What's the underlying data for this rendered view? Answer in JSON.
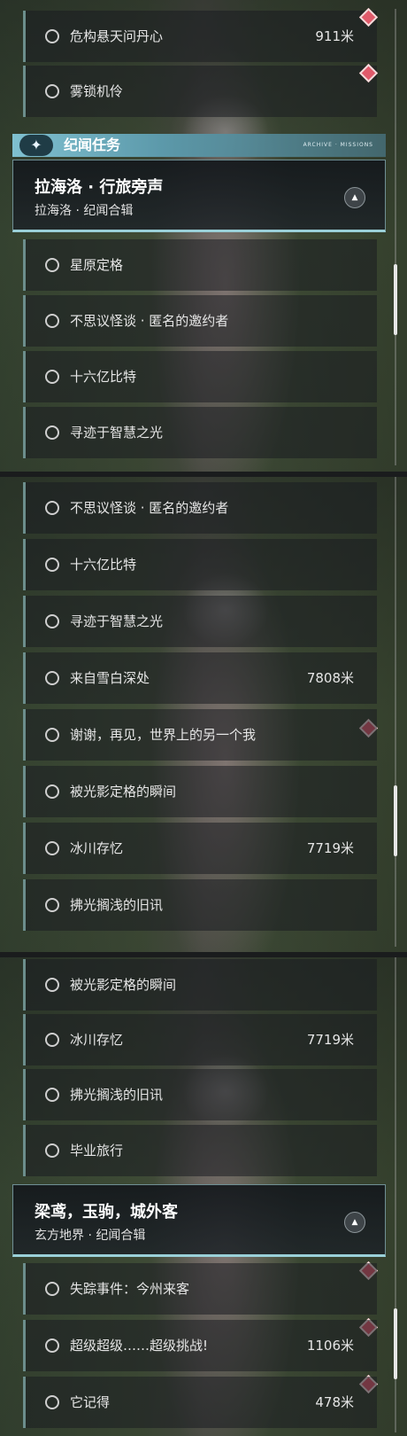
{
  "panel1": {
    "rows_top": [
      {
        "label": "危构悬天问丹心",
        "distance": "911米"
      },
      {
        "label": "雾锁机伶",
        "distance": ""
      }
    ],
    "section_title": "纪闻任务",
    "section_deco": "ARCHIVE · MISSIONS",
    "group": {
      "title": "拉海洛 · 行旅旁声",
      "subtitle": "拉海洛 · 纪闻合辑",
      "collapse_icon": "▲"
    },
    "rows_bottom": [
      {
        "label": "星原定格",
        "distance": ""
      },
      {
        "label": "不思议怪谈 · 匿名的邀约者",
        "distance": ""
      },
      {
        "label": "十六亿比特",
        "distance": ""
      },
      {
        "label": "寻迹于智慧之光",
        "distance": ""
      }
    ]
  },
  "panel2": {
    "rows": [
      {
        "label": "不思议怪谈 · 匿名的邀约者",
        "distance": ""
      },
      {
        "label": "十六亿比特",
        "distance": ""
      },
      {
        "label": "寻迹于智慧之光",
        "distance": ""
      },
      {
        "label": "来自雪白深处",
        "distance": "7808米"
      },
      {
        "label": "谢谢，再见，世界上的另一个我",
        "distance": ""
      },
      {
        "label": "被光影定格的瞬间",
        "distance": ""
      },
      {
        "label": "冰川存忆",
        "distance": "7719米"
      },
      {
        "label": "拂光搁浅的旧讯",
        "distance": ""
      }
    ]
  },
  "panel3": {
    "rows_top": [
      {
        "label": "被光影定格的瞬间",
        "distance": ""
      },
      {
        "label": "冰川存忆",
        "distance": "7719米"
      },
      {
        "label": "拂光搁浅的旧讯",
        "distance": ""
      },
      {
        "label": "毕业旅行",
        "distance": ""
      }
    ],
    "group": {
      "title": "梁鸢，玉驹，城外客",
      "subtitle": "玄方地界 · 纪闻合辑",
      "collapse_icon": "▲"
    },
    "rows_bottom": [
      {
        "label": "失踪事件：今州来客",
        "distance": ""
      },
      {
        "label": "超级超级……超级挑战!",
        "distance": "1106米"
      },
      {
        "label": "它记得",
        "distance": "478米"
      }
    ]
  },
  "icons": {
    "section_star": "✦",
    "marker": "diamond-marker"
  },
  "colors": {
    "accent": "#7fc0d0",
    "marker": "#e05a6a",
    "row_border": "#6c8e8c"
  }
}
